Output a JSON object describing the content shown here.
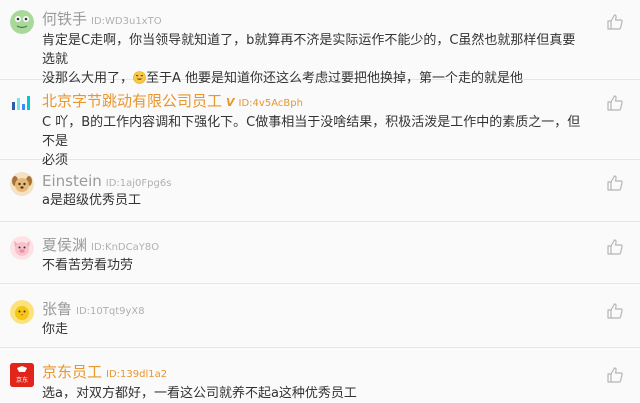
{
  "comments": [
    {
      "name": "何铁手",
      "id": "ID:WD3u1xTO",
      "lines": [
        "肯定是C走啊，你当领导就知道了，b就算再不济是实际运作不能少的，C虽然也就那样但真要选就",
        "没那么大用了，",
        "至于A 他要是知道你还这么考虑过要把他换掉，第一个走的就是他"
      ],
      "avatar_icon": "frog-avatar-icon",
      "like_icon": "thumbs-up-icon"
    },
    {
      "name": "北京字节跳动有限公司员工",
      "verified_mark": "V",
      "id": "ID:4v5AcBph",
      "lines": [
        "C 吖，B的工作内容调和下强化下。C做事相当于没啥结果，积极活泼是工作中的素质之一，但不是",
        "必须"
      ],
      "avatar_icon": "bytedance-logo-avatar-icon",
      "like_icon": "thumbs-up-icon"
    },
    {
      "name": "Einstein",
      "id": "ID:1aj0Fpg6s",
      "lines": [
        "a是超级优秀员工"
      ],
      "avatar_icon": "dog-avatar-icon",
      "like_icon": "thumbs-up-icon"
    },
    {
      "name": "夏侯渊",
      "id": "ID:KnDCaY8O",
      "lines": [
        "不看苦劳看功劳"
      ],
      "avatar_icon": "pig-avatar-icon",
      "like_icon": "thumbs-up-icon"
    },
    {
      "name": "张鲁",
      "id": "ID:10Tqt9yX8",
      "lines": [
        "你走"
      ],
      "avatar_icon": "chick-avatar-icon",
      "like_icon": "thumbs-up-icon"
    },
    {
      "name": "京东员工",
      "id": "ID:139dl1a2",
      "lines": [
        "选a，对双方都好，一看这公司就养不起a这种优秀员工"
      ],
      "avatar_icon": "jd-logo-avatar-icon",
      "avatar_text": "京东",
      "like_icon": "thumbs-up-icon"
    }
  ],
  "emoji_icon": "grinning-emoji-icon",
  "colors": {
    "vip_name": "#e8962e",
    "normal_name": "#9a9a9a",
    "text": "#333333",
    "divider": "#e6e6e6"
  }
}
